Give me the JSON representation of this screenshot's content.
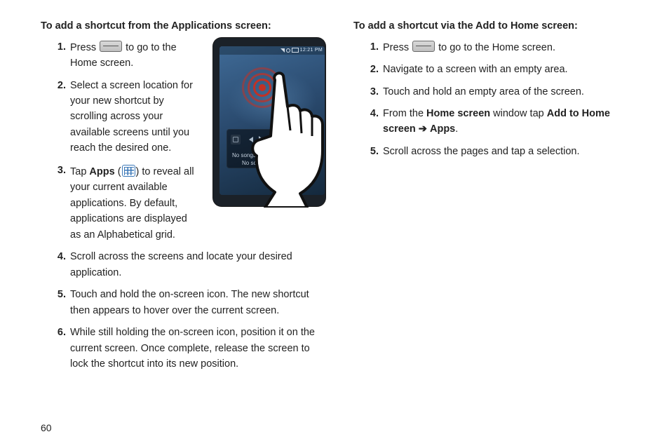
{
  "page_number": "60",
  "left": {
    "heading": "To add a shortcut from the Applications screen:",
    "steps": {
      "s1a": "Press ",
      "s1b": " to go to the Home screen.",
      "s2": "Select a screen location for your new shortcut by scrolling across your available screens until you reach the desired one.",
      "s3a": "Tap ",
      "s3_apps": "Apps",
      "s3b": " (",
      "s3c": ") to reveal all your current available applications. By default, applications are displayed as an Alphabetical grid.",
      "s4": "Scroll across the screens and locate your desired application.",
      "s5": "Touch and hold the on-screen icon. The new shortcut then appears to hover over the current screen.",
      "s6": "While still holding the on-screen icon, position it on the current screen. Once complete, release the screen to lock the shortcut into its new position."
    }
  },
  "right": {
    "heading": "To add a shortcut via the Add to Home screen:",
    "steps": {
      "s1a": "Press ",
      "s1b": " to go to the Home screen.",
      "s2": "Navigate to a screen with an empty area.",
      "s3": "Touch and hold an empty area of the screen.",
      "s4a": "From the ",
      "s4_hs": "Home screen",
      "s4b": " window tap ",
      "s4_add": "Add to Home screen",
      "s4c": " ",
      "s4_apps": "Apps",
      "s4d": ".",
      "s5": "Scroll across the pages and tap a selection."
    }
  },
  "phone": {
    "clock": "12:21 PM",
    "widget_label": "No songs playing",
    "widget_lower": "No son"
  },
  "icons": {
    "home_button": "home-button-icon",
    "apps_button": "apps-grid-icon",
    "arrow": "➔"
  }
}
